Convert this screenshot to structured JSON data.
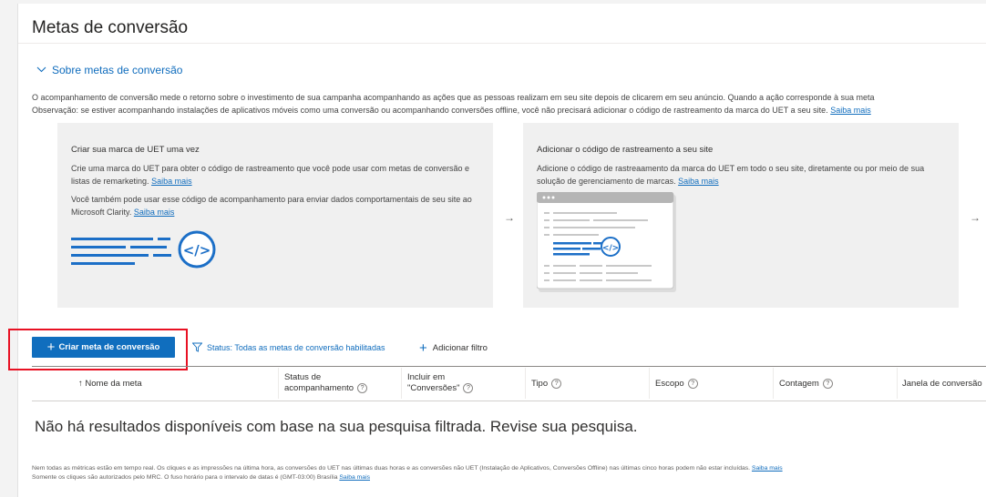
{
  "page": {
    "title": "Metas de conversão"
  },
  "about": {
    "toggle_label": "Sobre metas de conversão",
    "line1": "O acompanhamento de conversão mede o retorno sobre o investimento de sua campanha acompanhando as ações que as pessoas realizam em seu site depois de clicarem em seu anúncio. Quando a ação corresponde à sua meta",
    "line2": "Observação: se estiver acompanhando instalações de aplicativos móveis como uma conversão ou acompanhando conversões offline, você não precisará adicionar o código de rastreamento da marca do UET a seu site.",
    "learn_more": "Saiba mais"
  },
  "cards": {
    "card1": {
      "title": "Criar sua marca de UET uma vez",
      "p1": "Crie uma marca do UET para obter o código de rastreamento que você pode usar com metas de conversão e listas de remarketing.",
      "p2": "Você também pode usar esse código de acompanhamento para enviar dados comportamentais de seu site ao Microsoft Clarity.",
      "link": "Saiba mais"
    },
    "card2": {
      "title": "Adicionar o código de rastreamento a seu site",
      "p1": "Adicione o código de rastreaamento da marca do UET em todo o seu site, diretamente ou por meio de sua solução de gerenciamento de marcas.",
      "link": "Saiba mais"
    },
    "arrow": "→"
  },
  "toolbar": {
    "create_label": "Criar meta de conversão",
    "filter_label": "Status: Todas as metas de conversão habilitadas",
    "add_filter_label": "Adicionar filtro"
  },
  "table": {
    "columns": [
      {
        "line1": "Nome da meta",
        "line2": ""
      },
      {
        "line1": "Status de",
        "line2": "acompanhamento"
      },
      {
        "line1": "Incluir em",
        "line2": "\"Conversões\""
      },
      {
        "line1": "Tipo",
        "line2": ""
      },
      {
        "line1": "Escopo",
        "line2": ""
      },
      {
        "line1": "Contagem",
        "line2": ""
      },
      {
        "line1": "Janela de conversão",
        "line2": ""
      }
    ],
    "sort_glyph": "↑",
    "help_glyph": "?",
    "empty_message": "Não há resultados disponíveis com base na sua pesquisa filtrada. Revise sua pesquisa."
  },
  "footer": {
    "line1": "Nem todas as métricas estão em tempo real. Os cliques e as impressões na última hora, as conversões do UET nas últimas duas horas e as conversões não UET (Instalação de Aplicativos, Conversões Offline) nas últimas cinco horas podem não estar incluídas.",
    "line2": "Somente os cliques são autorizados pelo MRC. O fuso horário para o intervalo de datas é (GMT-03:00) Brasília",
    "learn_more": "Saiba mais"
  },
  "colors": {
    "accent": "#106ebe",
    "link": "#0f6cbd",
    "highlight": "#e81123",
    "card_bg": "#f0f0f0"
  }
}
